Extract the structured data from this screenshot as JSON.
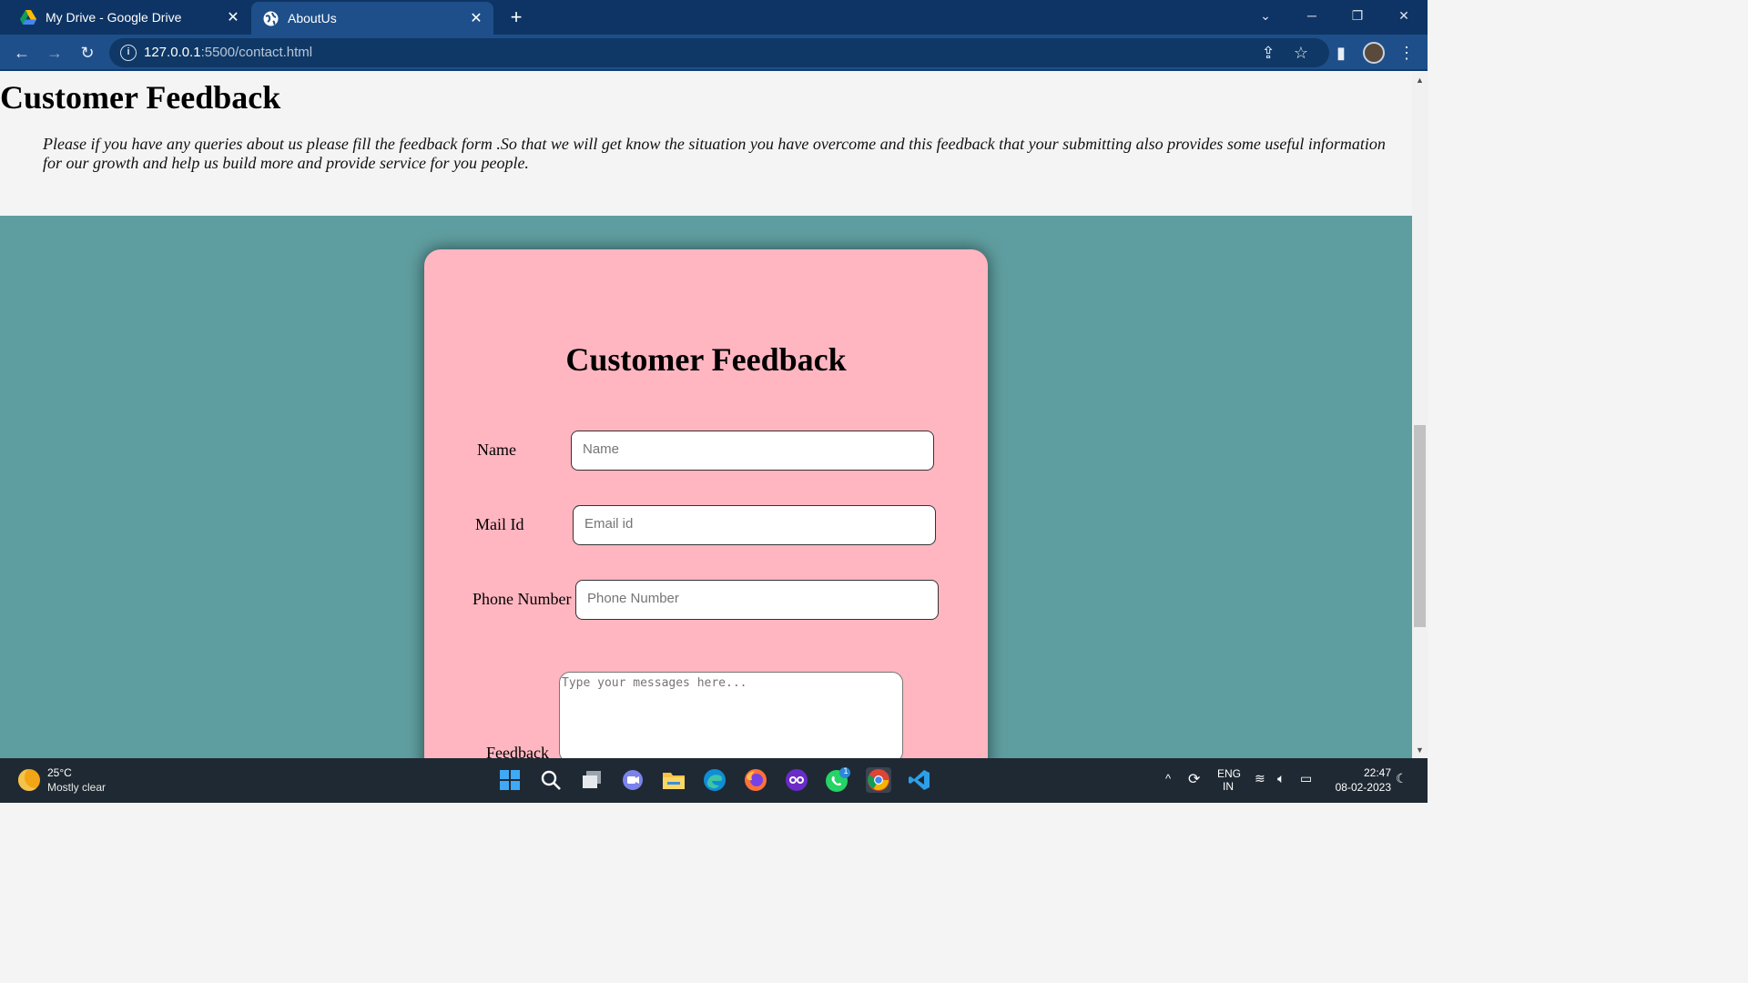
{
  "browser": {
    "tabs": [
      {
        "title": "My Drive - Google Drive",
        "active": false
      },
      {
        "title": "AboutUs",
        "active": true
      }
    ],
    "new_tab": "+",
    "window_controls": {
      "minimize": "─",
      "restore": "❐",
      "close": "✕",
      "tab_search": "⌄"
    },
    "toolbar": {
      "back": "←",
      "forward": "→",
      "reload": "↻"
    },
    "url_host": "127.0.0.1",
    "url_path": ":5500/contact.html",
    "toolbar_right": {
      "share": "⇪",
      "bookmark": "☆",
      "side_panel": "▮",
      "menu": "⋮"
    }
  },
  "page": {
    "heading": "Customer Feedback",
    "intro": "Please if you have any queries about us please fill the feedback form .So that we will get know the situation you have overcome and this feedback that your submitting also provides some useful information for our growth and help us build more and provide service for you people.",
    "form": {
      "title": "Customer Feedback",
      "name_label": "Name",
      "name_placeholder": "Name",
      "email_label": "Mail Id",
      "email_placeholder": "Email id",
      "phone_label": "Phone Number",
      "phone_placeholder": "Phone Number",
      "feedback_label": "Feedback",
      "feedback_placeholder": "Type your messages here..."
    },
    "colors": {
      "section_bg": "#5f9ea0",
      "card_bg": "#ffb6c1",
      "page_bg": "#f4f4f4"
    }
  },
  "taskbar": {
    "weather_temp": "25°C",
    "weather_desc": "Mostly clear",
    "apps": [
      "windows-start",
      "search",
      "task-view",
      "teams-chat",
      "file-explorer",
      "edge",
      "firefox",
      "app-purple",
      "whatsapp",
      "chrome",
      "vscode"
    ],
    "whatsapp_badge": "1",
    "lang_top": "ENG",
    "lang_bottom": "IN",
    "time": "22:47",
    "date": "08-02-2023",
    "chevron": "^"
  }
}
